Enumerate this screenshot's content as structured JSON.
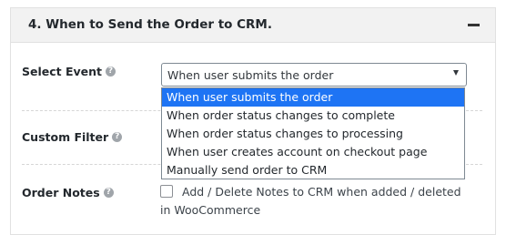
{
  "panel": {
    "title": "4. When to Send the Order to CRM."
  },
  "select_event": {
    "label": "Select Event",
    "value": "When user submits the order",
    "options": [
      "When user submits the order",
      "When order status changes to complete",
      "When order status changes to processing",
      "When user creates account on checkout page",
      "Manually send order to CRM"
    ],
    "highlighted_index": 0
  },
  "custom_filter": {
    "label": "Custom Filter"
  },
  "order_notes": {
    "label": "Order Notes",
    "checkbox_text": "Add / Delete Notes to CRM when added / deleted in WooCommerce",
    "checked": false
  },
  "icons": {
    "help": "help-question-icon",
    "collapse": "minus-icon",
    "dropdown_arrow": "triangle-down-icon"
  },
  "colors": {
    "header_bg": "#f2f2f2",
    "highlight": "#1e74f4",
    "border": "#7e8993"
  }
}
